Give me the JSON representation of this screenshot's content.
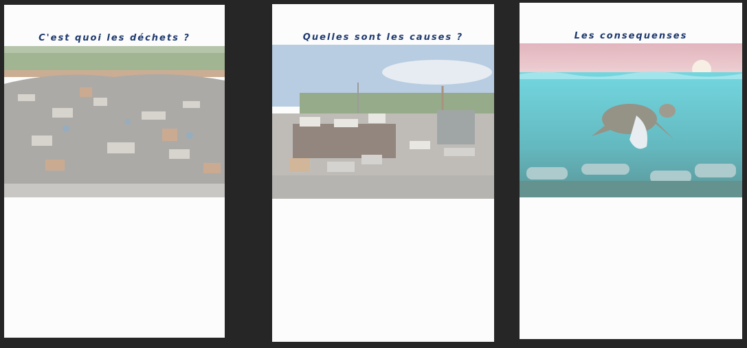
{
  "cards": [
    {
      "title": "C'est quoi les déchets ?",
      "image": "waste-pile-photo"
    },
    {
      "title": "Quelles sont les causes ?",
      "image": "overflowing-bins-photo"
    },
    {
      "title": "Les consequenses",
      "image": "sea-turtle-plastic-photo"
    }
  ],
  "colors": {
    "background": "#262626",
    "card": "#fcfcfc",
    "title": "#1e3a6e"
  }
}
